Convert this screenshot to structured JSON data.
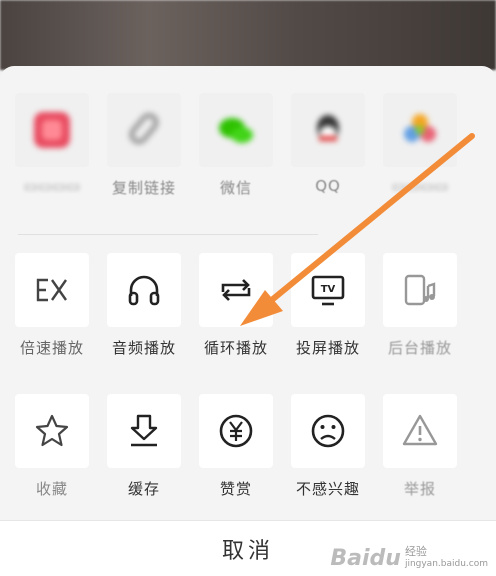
{
  "share_row": [
    {
      "label": "",
      "icon": "red-app-icon",
      "color": "#e84a5f"
    },
    {
      "label": "复制链接",
      "icon": "link-icon",
      "color": "#9a9a9a"
    },
    {
      "label": "微信",
      "icon": "wechat-icon",
      "color": "#2dc100"
    },
    {
      "label": "QQ",
      "icon": "qq-icon",
      "color": "#333333"
    },
    {
      "label": "",
      "icon": "photos-icon",
      "color": "#f5a623"
    }
  ],
  "feature_row": [
    {
      "label": "倍速播放",
      "icon": "speed-icon"
    },
    {
      "label": "音频播放",
      "icon": "headphones-icon"
    },
    {
      "label": "循环播放",
      "icon": "loop-icon"
    },
    {
      "label": "投屏播放",
      "icon": "tv-cast-icon",
      "badge": "TV"
    },
    {
      "label": "后台播放",
      "icon": "background-play-icon"
    }
  ],
  "action_row": [
    {
      "label": "收藏",
      "icon": "star-icon"
    },
    {
      "label": "缓存",
      "icon": "download-icon"
    },
    {
      "label": "赞赏",
      "icon": "yen-coin-icon"
    },
    {
      "label": "不感兴趣",
      "icon": "sad-face-icon"
    },
    {
      "label": "举报",
      "icon": "warning-icon"
    }
  ],
  "cancel_label": "取消",
  "annotation_arrow_color": "#f28c38",
  "watermark": {
    "brand": "Baidu",
    "line1": "经验",
    "line2": "jingyan.baidu.com"
  }
}
